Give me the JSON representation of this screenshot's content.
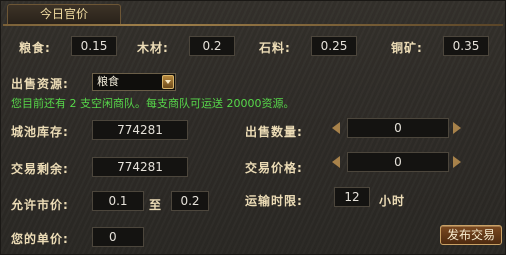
{
  "title": "今日官价",
  "prices": [
    {
      "label": "粮食:",
      "value": "0.15"
    },
    {
      "label": "木材:",
      "value": "0.2"
    },
    {
      "label": "石料:",
      "value": "0.25"
    },
    {
      "label": "铜矿:",
      "value": "0.35"
    }
  ],
  "resource": {
    "label": "出售资源:",
    "selected": "粮食"
  },
  "notice": "您目前还有 2 支空闲商队。每支商队可运送 20000资源。",
  "stock": {
    "label": "城池库存:",
    "value": "774281"
  },
  "remaining": {
    "label": "交易剩余:",
    "value": "774281"
  },
  "market": {
    "label": "允许市价:",
    "min": "0.1",
    "sep": "至",
    "max": "0.2"
  },
  "unit_price": {
    "label": "您的单价:",
    "value": "0"
  },
  "sell_qty": {
    "label": "出售数量:",
    "value": "0"
  },
  "trade_price": {
    "label": "交易价格:",
    "value": "0"
  },
  "transport": {
    "label": "运输时限:",
    "value": "12",
    "unit": "小时"
  },
  "publish_button": "发布交易"
}
